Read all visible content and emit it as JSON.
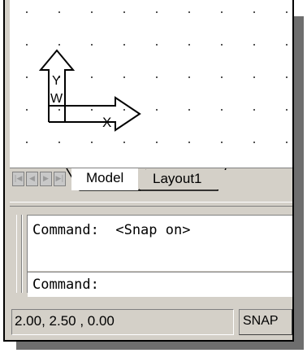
{
  "tabs": {
    "model_label": "Model",
    "layout_label": "Layout1"
  },
  "nav_icons": [
    "first-tab-icon",
    "previous-tab-icon",
    "next-tab-icon",
    "last-tab-icon"
  ],
  "ucs_icon": {
    "y_label": "Y",
    "w_label": "W",
    "x_label": "X"
  },
  "command": {
    "history_line": "Command:  <Snap on>",
    "prompt": "Command:"
  },
  "status": {
    "coordinates": "2.00, 2.50 , 0.00",
    "snap_label": "SNAP"
  },
  "colors": {
    "background": "#ffffff",
    "panel": "#d4d0c8",
    "shadow": "#6e6e6e"
  }
}
